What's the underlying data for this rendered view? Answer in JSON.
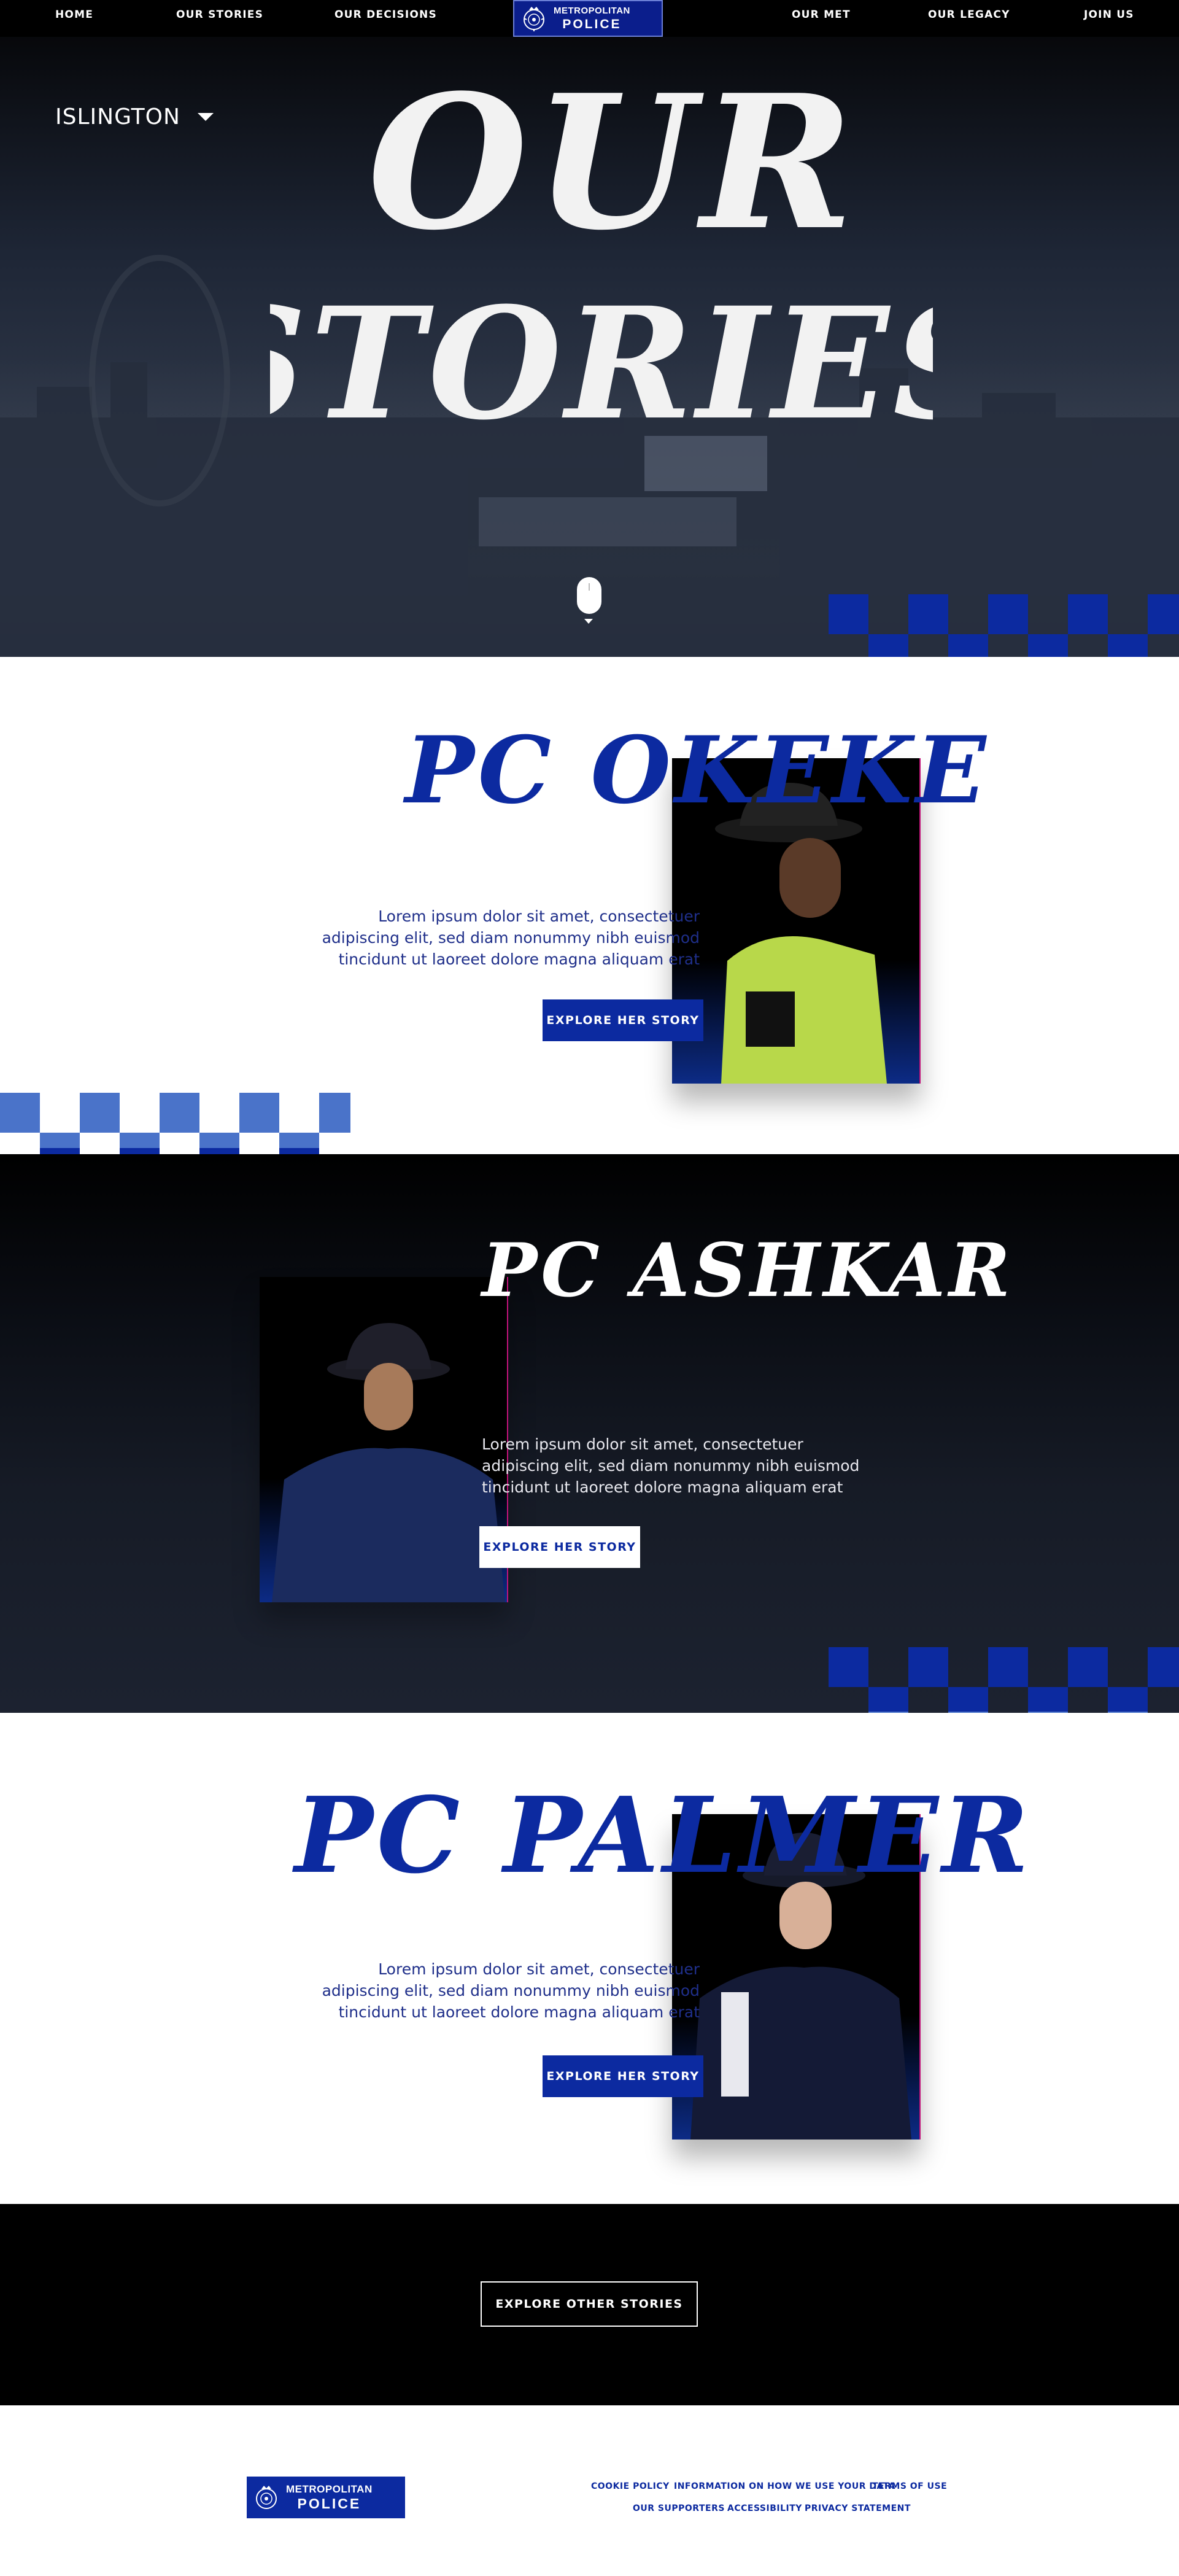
{
  "nav": {
    "home": "HOME",
    "our_stories": "OUR STORIES",
    "our_decisions": "OUR DECISIONS",
    "our_met": "OUR MET",
    "our_legacy": "OUR LEGACY",
    "join_us": "JOIN US",
    "active": "OUR STORIES"
  },
  "logo": {
    "line1": "METROPOLITAN",
    "line2": "POLICE"
  },
  "hero": {
    "borough": "ISLINGTON",
    "title_line1": "OUR",
    "title_line2": "STORIES"
  },
  "stories": [
    {
      "name": "PC OKEKE",
      "text": "Lorem ipsum dolor sit amet, consectetuer adipiscing elit, sed diam nonummy nibh euismod tincidunt ut laoreet dolore magna aliquam erat",
      "button": "EXPLORE HER STORY"
    },
    {
      "name": "PC ASHKAR",
      "text": "Lorem ipsum dolor sit amet, consectetuer adipiscing elit, sed diam nonummy nibh euismod tincidunt ut laoreet dolore magna aliquam erat",
      "button": "EXPLORE HER STORY"
    },
    {
      "name": "PC PALMER",
      "text": "Lorem ipsum dolor sit amet, consectetuer adipiscing elit, sed diam nonummy nibh euismod tincidunt ut laoreet dolore magna aliquam erat",
      "button": "EXPLORE HER STORY"
    }
  ],
  "explore_other": "EXPLORE OTHER STORIES",
  "footer": {
    "links_row1": [
      "COOKIE POLICY",
      "INFORMATION ON HOW WE USE YOUR DATA",
      "TERMS OF USE"
    ],
    "links_row2": [
      "OUR SUPPORTERS",
      "ACCESSIBILITY",
      "PRIVACY STATEMENT"
    ]
  },
  "colors": {
    "brand_blue": "#0c2aa0",
    "light_blue": "#4a73c9",
    "accent_pink": "#e0208a",
    "black": "#000000"
  },
  "icons": [
    "met-police-crest-icon",
    "chevron-down-icon",
    "scroll-mouse-icon"
  ]
}
